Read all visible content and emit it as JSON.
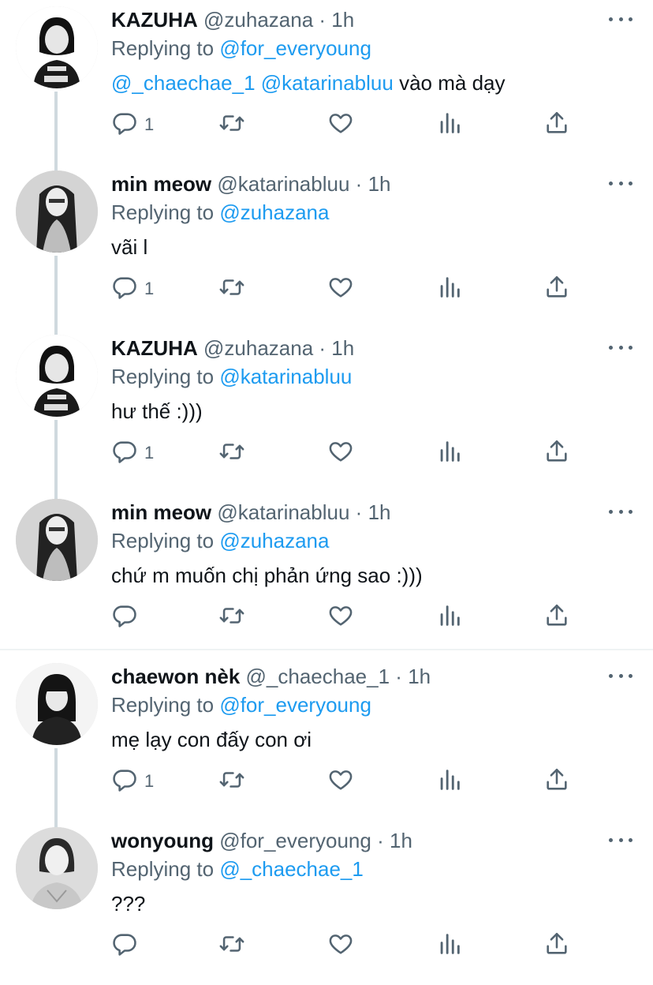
{
  "tweets": [
    {
      "name": "KAZUHA",
      "handle": "@zuhazana",
      "dot": "·",
      "time": "1h",
      "replying_prefix": "Replying to",
      "replying_to": "@for_everyoung",
      "mentions": [
        "@_chaechae_1",
        "@katarinabluu"
      ],
      "text": "vào mà dạy",
      "reply_count": "1",
      "avatar": "kazuha"
    },
    {
      "name": "min meow",
      "handle": "@katarinabluu",
      "dot": "·",
      "time": "1h",
      "replying_prefix": "Replying to",
      "replying_to": "@zuhazana",
      "mentions": [],
      "text": "vãi l",
      "reply_count": "1",
      "avatar": "minmeow"
    },
    {
      "name": "KAZUHA",
      "handle": "@zuhazana",
      "dot": "·",
      "time": "1h",
      "replying_prefix": "Replying to",
      "replying_to": "@katarinabluu",
      "mentions": [],
      "text": "hư thế :)))",
      "reply_count": "1",
      "avatar": "kazuha"
    },
    {
      "name": "min meow",
      "handle": "@katarinabluu",
      "dot": "·",
      "time": "1h",
      "replying_prefix": "Replying to",
      "replying_to": "@zuhazana",
      "mentions": [],
      "text": "chứ m muốn chị phản ứng sao :)))",
      "reply_count": "",
      "avatar": "minmeow"
    },
    {
      "name": "chaewon nèk",
      "handle": "@_chaechae_1",
      "dot": "·",
      "time": "1h",
      "replying_prefix": "Replying to",
      "replying_to": "@for_everyoung",
      "mentions": [],
      "text": "mẹ lạy con đấy con ơi",
      "reply_count": "1",
      "avatar": "chaewon"
    },
    {
      "name": "wonyoung",
      "handle": "@for_everyoung",
      "dot": "·",
      "time": "1h",
      "replying_prefix": "Replying to",
      "replying_to": "@_chaechae_1",
      "mentions": [],
      "text": "???",
      "reply_count": "",
      "avatar": "wonyoung"
    }
  ],
  "colors": {
    "link": "#1d9bf0",
    "secondary": "#536471",
    "thread_line": "#cfd9de",
    "divider": "#eff3f4"
  },
  "icons": [
    "reply-icon",
    "retweet-icon",
    "like-icon",
    "analytics-icon",
    "share-icon",
    "more-icon"
  ]
}
